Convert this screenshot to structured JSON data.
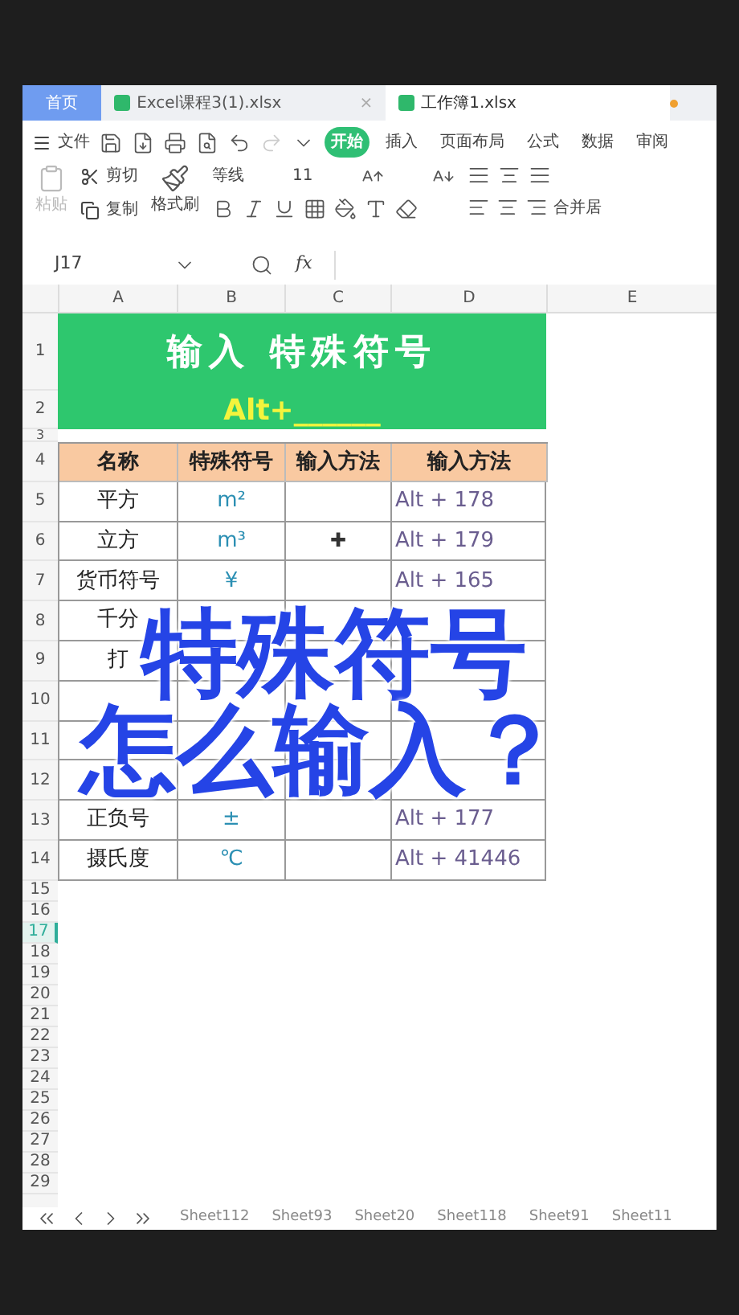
{
  "tabs": [
    {
      "kind": "home",
      "label": "首页"
    },
    {
      "kind": "file",
      "label": "Excel课程3(1).xlsx",
      "selected": false,
      "close": "×"
    },
    {
      "kind": "file",
      "label": "工作簿1.xlsx",
      "selected": true
    }
  ],
  "menu": {
    "file": "文件",
    "ribbon_tabs": [
      {
        "label": "开始",
        "selected": true
      },
      {
        "label": "插入",
        "selected": false
      },
      {
        "label": "页面布局",
        "selected": false
      },
      {
        "label": "公式",
        "selected": false
      },
      {
        "label": "数据",
        "selected": false
      },
      {
        "label": "审阅",
        "selected": false
      }
    ]
  },
  "toolbar": {
    "paste": "粘贴",
    "cut": "剪切",
    "copy": "复制",
    "format_painter": "格式刷",
    "font": "等线",
    "size": "11",
    "merge": "合并居"
  },
  "formula_bar": {
    "name_box": "J17",
    "fx": "fx"
  },
  "columns": [
    "A",
    "B",
    "C",
    "D",
    "E"
  ],
  "sheet": {
    "title": "输入 特殊符号",
    "subtitle": "Alt+______",
    "header": [
      "名称",
      "特殊符号",
      "输入方法",
      "输入方法"
    ],
    "rows": [
      {
        "name": "平方",
        "symbol": "m²",
        "c": "",
        "method": "Alt + 178"
      },
      {
        "name": "立方",
        "symbol": "m³",
        "c": "✚",
        "method": "Alt + 179"
      },
      {
        "name": "货币符号",
        "symbol": "¥",
        "c": "",
        "method": "Alt + 165"
      },
      {
        "name": "千分",
        "symbol": "",
        "c": "",
        "method": ""
      },
      {
        "name": "打",
        "symbol": "",
        "c": "",
        "method": ""
      },
      {
        "name": "",
        "symbol": "",
        "c": "",
        "method": ""
      },
      {
        "name": "",
        "symbol": "",
        "c": "",
        "method": ""
      },
      {
        "name": "",
        "symbol": "",
        "c": "",
        "method": ""
      },
      {
        "name": "正负号",
        "symbol": "±",
        "c": "",
        "method": "Alt + 177"
      },
      {
        "name": "摄氏度",
        "symbol": "℃",
        "c": "",
        "method": "Alt + 41446"
      }
    ]
  },
  "row_numbers": [
    {
      "label": "1",
      "selected": false
    },
    {
      "label": "2",
      "selected": false
    },
    {
      "label": "3",
      "selected": false
    },
    {
      "label": "4",
      "selected": false
    },
    {
      "label": "5",
      "selected": false
    },
    {
      "label": "6",
      "selected": false
    },
    {
      "label": "7",
      "selected": false
    },
    {
      "label": "8",
      "selected": false
    },
    {
      "label": "9",
      "selected": false
    },
    {
      "label": "10",
      "selected": false
    },
    {
      "label": "11",
      "selected": false
    },
    {
      "label": "12",
      "selected": false
    },
    {
      "label": "13",
      "selected": false
    },
    {
      "label": "14",
      "selected": false
    },
    {
      "label": "15",
      "selected": false
    },
    {
      "label": "16",
      "selected": false
    },
    {
      "label": "17",
      "selected": true
    },
    {
      "label": "18",
      "selected": false
    },
    {
      "label": "19",
      "selected": false
    },
    {
      "label": "20",
      "selected": false
    },
    {
      "label": "21",
      "selected": false
    },
    {
      "label": "22",
      "selected": false
    },
    {
      "label": "23",
      "selected": false
    },
    {
      "label": "24",
      "selected": false
    },
    {
      "label": "25",
      "selected": false
    },
    {
      "label": "26",
      "selected": false
    },
    {
      "label": "27",
      "selected": false
    },
    {
      "label": "28",
      "selected": false
    },
    {
      "label": "29",
      "selected": false
    }
  ],
  "overlay": {
    "line_1": "特殊符号",
    "line_2": "怎么输入？"
  },
  "sheet_tabs": [
    "Sheet112",
    "Sheet93",
    "Sheet20",
    "Sheet118",
    "Sheet91",
    "Sheet11"
  ]
}
